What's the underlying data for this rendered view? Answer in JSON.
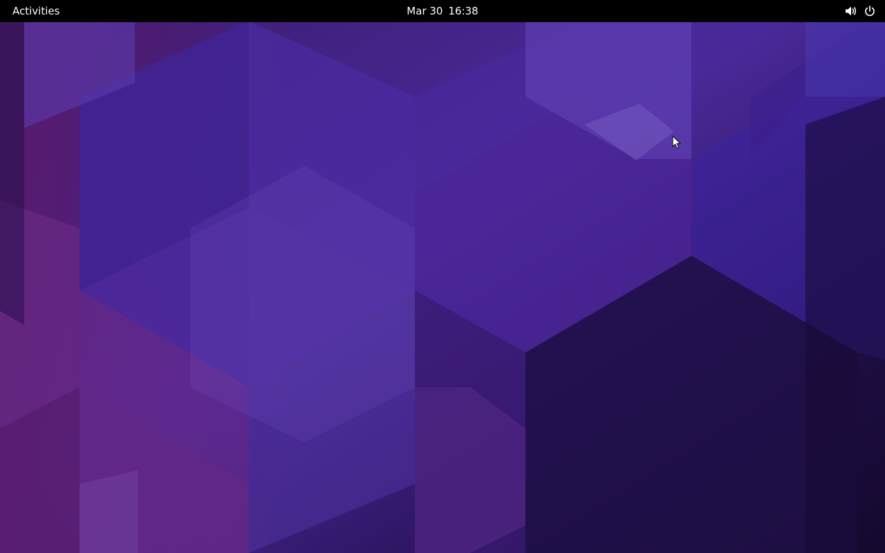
{
  "top_bar": {
    "activities_label": "Activities",
    "date": "Mar 30",
    "time": "16:38",
    "icons": [
      "volume-icon",
      "power-icon"
    ]
  },
  "wallpaper": {
    "style": "purple-hexagonal-cubes",
    "colors": [
      "#2a1250",
      "#4a2a9e",
      "#5b34b0",
      "#6b2a8e",
      "#1e0e3c"
    ]
  }
}
